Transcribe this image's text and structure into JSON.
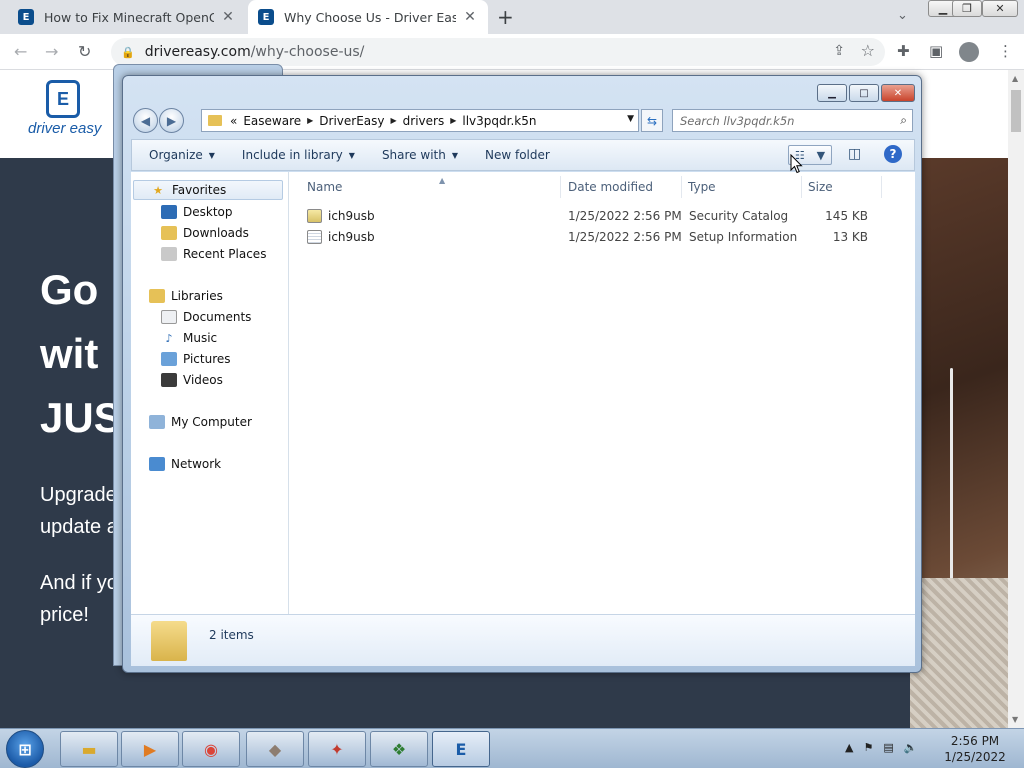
{
  "browser": {
    "tabs": [
      {
        "label": "How to Fix Minecraft OpenGL Err",
        "active": false
      },
      {
        "label": "Why Choose Us - Driver Easy",
        "active": true
      }
    ],
    "url_domain": "drivereasy.com",
    "url_path": "/why-choose-us/"
  },
  "site": {
    "logo_text": "driver easy",
    "hero_lines": [
      "Go",
      "wit",
      "JUS"
    ],
    "body_lines": [
      "Upgrade",
      "update a",
      "And if yo",
      "price!"
    ]
  },
  "explorer": {
    "breadcrumb": [
      "«",
      "Easeware",
      "DriverEasy",
      "drivers",
      "llv3pqdr.k5n"
    ],
    "search_placeholder": "Search llv3pqdr.k5n",
    "commands": [
      "Organize",
      "Include in library",
      "Share with",
      "New folder"
    ],
    "nav": {
      "favorites": "Favorites",
      "favorites_items": [
        "Desktop",
        "Downloads",
        "Recent Places"
      ],
      "libraries": "Libraries",
      "libraries_items": [
        "Documents",
        "Music",
        "Pictures",
        "Videos"
      ],
      "computer": "My Computer",
      "network": "Network"
    },
    "columns": [
      "Name",
      "Date modified",
      "Type",
      "Size"
    ],
    "files": [
      {
        "name": "ich9usb",
        "date": "1/25/2022 2:56 PM",
        "type": "Security Catalog",
        "size": "145 KB",
        "icon": "security-catalog-icon"
      },
      {
        "name": "ich9usb",
        "date": "1/25/2022 2:56 PM",
        "type": "Setup Information",
        "size": "13 KB",
        "icon": "setup-information-icon"
      }
    ],
    "item_count": "2 items"
  },
  "taskbar": {
    "time": "2:56 PM",
    "date": "1/25/2022"
  },
  "colors": {
    "brand_blue": "#1a5ca8",
    "hero_bg": "#2f3a4a",
    "accent_orange": "#f07a3b"
  }
}
